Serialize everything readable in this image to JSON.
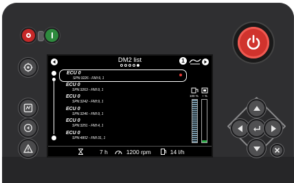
{
  "screen": {
    "title": "DM2 list",
    "page_indicator": {
      "total": 5,
      "active": 5
    },
    "rows": [
      {
        "ecu": "ECU 0",
        "spn": "SPN:3226 - FMI:9, 1",
        "selected": true
      },
      {
        "ecu": "ECU 0",
        "spn": "SPN:3263 - FMI:9, 1",
        "selected": false
      },
      {
        "ecu": "ECU 0",
        "spn": "SPN:3242 - FMI:9, 1",
        "selected": false
      },
      {
        "ecu": "ECU 0",
        "spn": "SPN:3246 - FMI:9, 1",
        "selected": false
      },
      {
        "ecu": "ECU 0",
        "spn": "SPN:3251 - FMI:4, 1",
        "selected": false
      },
      {
        "ecu": "ECU 0",
        "spn": "SPN:4802 - FMI:31, 1",
        "selected": false
      }
    ],
    "gauges": {
      "fuel_label": "100 %",
      "fuel_level_percent": 100,
      "other_label": "+ %",
      "other_level_percent": 5
    },
    "status": {
      "hours": "7 h",
      "rpm": "1200 rpm",
      "fuel_rate": "14 l/h"
    },
    "icons": [
      "arrow-left-icon",
      "info-icon",
      "engine-icon",
      "arrow-right-icon",
      "hourglass-icon",
      "tachometer-icon",
      "fuel-pump-icon"
    ]
  },
  "hardware": {
    "left_buttons": [
      "settings-icon",
      "diagnostics-icon",
      "cycle-icon",
      "warning-icon"
    ],
    "dpad": [
      "arrow-up-icon",
      "arrow-left-icon",
      "enter-icon",
      "arrow-right-icon",
      "arrow-down-icon"
    ],
    "close_icon": "close-icon"
  },
  "colors": {
    "housing": "#2f2f31",
    "power": "#d0332d",
    "stop": "#c62828",
    "start": "#2e8b3e",
    "gauge_green": "#2fae4a",
    "selection_mark": "#e53935"
  }
}
